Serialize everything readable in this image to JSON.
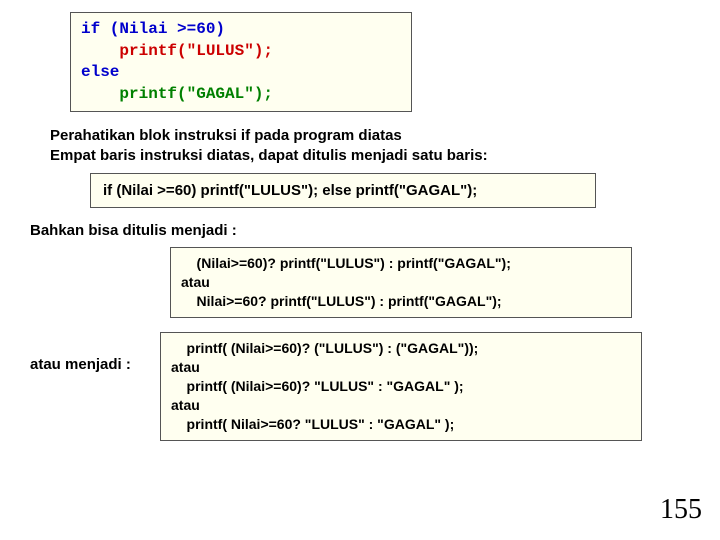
{
  "code_block": {
    "l1": "if (Nilai >=60)",
    "l2": "    printf(\"LULUS\");",
    "l3": "else",
    "l4": "    printf(\"GAGAL\");"
  },
  "explain": {
    "l1": "Perahatikan blok instruksi if pada program diatas",
    "l2": "Empat baris instruksi diatas, dapat ditulis menjadi satu baris:"
  },
  "oneline": "if (Nilai >=60) printf(\"LULUS\"); else printf(\"GAGAL\");",
  "bahkan": "Bahkan bisa ditulis menjadi :",
  "ternary": {
    "l1": "    (Nilai>=60)? printf(\"LULUS\") : printf(\"GAGAL\");",
    "l2": "atau",
    "l3": "    Nilai>=60? printf(\"LULUS\") : printf(\"GAGAL\");"
  },
  "atau_label": "atau menjadi :",
  "final": {
    "l1": "    printf( (Nilai>=60)? (\"LULUS\") : (\"GAGAL\"));",
    "l2": "atau",
    "l3": "    printf( (Nilai>=60)? \"LULUS\" : \"GAGAL\" );",
    "l4": "atau",
    "l5": "    printf( Nilai>=60? \"LULUS\" : \"GAGAL\" );"
  },
  "page_number": "155"
}
